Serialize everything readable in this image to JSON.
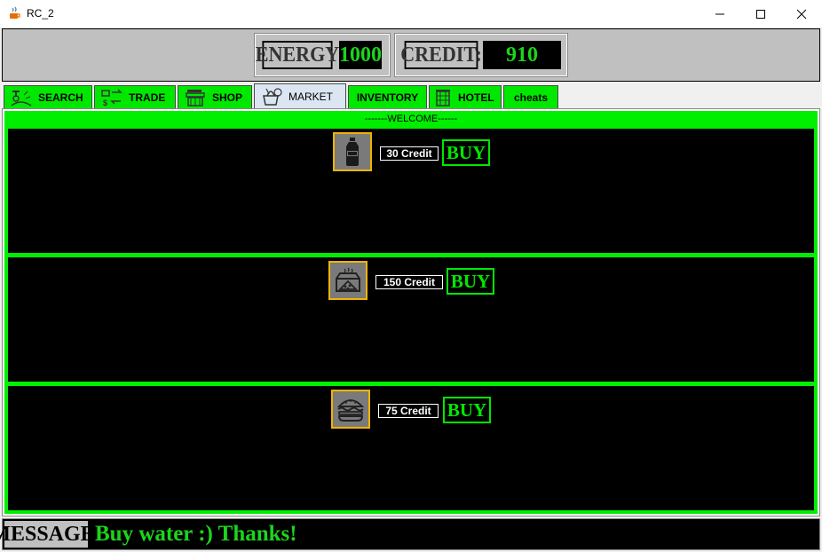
{
  "window": {
    "title": "RC_2"
  },
  "header": {
    "energy_label": "ENERGY",
    "energy_value": "1000",
    "credit_label": "CREDIT:",
    "credit_value": "910"
  },
  "tabs": [
    {
      "label": "SEARCH",
      "icon": "search-harvest-icon"
    },
    {
      "label": "TRADE",
      "icon": "trade-exchange-icon"
    },
    {
      "label": "SHOP",
      "icon": "shop-icon"
    },
    {
      "label": "MARKET",
      "icon": "market-basket-icon",
      "active": true
    },
    {
      "label": "INVENTORY"
    },
    {
      "label": "HOTEL",
      "icon": "hotel-icon"
    },
    {
      "label": "cheats"
    }
  ],
  "market": {
    "welcome": "-------WELCOME------",
    "items": [
      {
        "icon": "water-bottle-icon",
        "price": "30 Credit",
        "buy_label": "BUY"
      },
      {
        "icon": "pizza-box-icon",
        "price": "150 Credit",
        "buy_label": "BUY"
      },
      {
        "icon": "burger-icon",
        "price": "75 Credit",
        "buy_label": "BUY"
      }
    ]
  },
  "message": {
    "label": "MESSAGE:",
    "text": "Buy water :) Thanks!"
  },
  "colors": {
    "accent_green": "#00e800",
    "text_green": "#1bd51b",
    "panel_gray": "#c0c0c0",
    "icon_border": "#f0b400"
  }
}
